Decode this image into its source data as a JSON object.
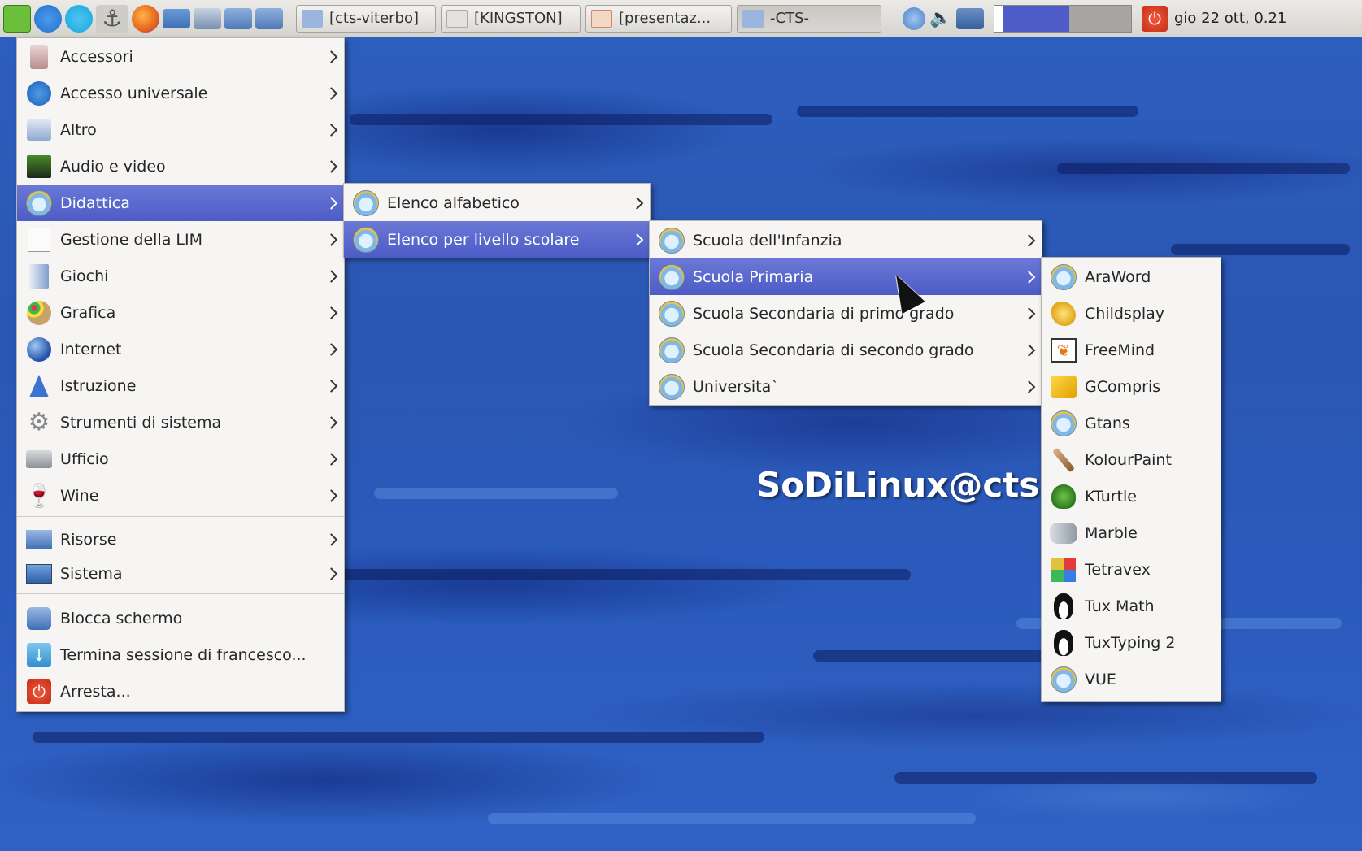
{
  "panel": {
    "launchers": [
      {
        "icon": "mint-menu-icon",
        "color": "#6cbf3a"
      },
      {
        "icon": "info-icon",
        "color": "#1f6fd1"
      },
      {
        "icon": "skype-icon",
        "color": "#18a7e0"
      },
      {
        "icon": "anchor-icon",
        "color": "#666666"
      },
      {
        "icon": "firefox-icon",
        "color": "#e8641b"
      },
      {
        "icon": "monitor-icon",
        "color": "#3d6fb5"
      },
      {
        "icon": "workspace-icon",
        "color": "#7790b0"
      },
      {
        "icon": "workspace-icon",
        "color": "#4f79b8"
      },
      {
        "icon": "workspace-icon",
        "color": "#4f79b8"
      }
    ],
    "tasks": [
      {
        "label": "[cts-viterbo]",
        "icon": "folder-icon"
      },
      {
        "label": "[KINGSTON]",
        "icon": "drive-icon"
      },
      {
        "label": "[presentaz...",
        "icon": "presentation-icon"
      },
      {
        "label": "-CTS-",
        "icon": "folder-icon"
      }
    ],
    "tray": [
      "info-icon",
      "volume-icon",
      "network-icon"
    ],
    "clock": "gio 22 ott, 0.21"
  },
  "wallpaper_text": "SoDiLinux@cts",
  "main_menu": {
    "categories": [
      {
        "label": "Accessori",
        "icon": "accessories-icon"
      },
      {
        "label": "Accesso universale",
        "icon": "accessibility-icon"
      },
      {
        "label": "Altro",
        "icon": "other-icon"
      },
      {
        "label": "Audio e video",
        "icon": "audio-video-icon"
      },
      {
        "label": "Didattica",
        "icon": "education-owl-icon"
      },
      {
        "label": "Gestione della LIM",
        "icon": "whiteboard-icon"
      },
      {
        "label": "Giochi",
        "icon": "games-icon"
      },
      {
        "label": "Grafica",
        "icon": "graphics-icon"
      },
      {
        "label": "Internet",
        "icon": "internet-globe-icon"
      },
      {
        "label": "Istruzione",
        "icon": "science-flask-icon"
      },
      {
        "label": "Strumenti di sistema",
        "icon": "gear-icon"
      },
      {
        "label": "Ufficio",
        "icon": "office-icon"
      },
      {
        "label": "Wine",
        "icon": "wine-glass-icon"
      }
    ],
    "places": [
      {
        "label": "Risorse",
        "icon": "places-icon"
      },
      {
        "label": "Sistema",
        "icon": "system-icon"
      }
    ],
    "actions": [
      {
        "label": "Blocca schermo",
        "icon": "lock-screen-icon"
      },
      {
        "label": "Termina sessione di francesco...",
        "icon": "logout-icon"
      },
      {
        "label": "Arresta...",
        "icon": "power-icon"
      }
    ]
  },
  "submenu_didattica": [
    "Elenco alfabetico",
    "Elenco per livello scolare"
  ],
  "submenu_livello": [
    "Scuola dell'Infanzia",
    "Scuola Primaria",
    "Scuola Secondaria di primo grado",
    "Scuola Secondaria di secondo grado",
    "Universita`"
  ],
  "submenu_primaria": [
    {
      "label": "AraWord",
      "icon": "owl-icon"
    },
    {
      "label": "Childsplay",
      "icon": "childsplay-hand-icon"
    },
    {
      "label": "FreeMind",
      "icon": "butterfly-icon"
    },
    {
      "label": "GCompris",
      "icon": "gcompris-icon"
    },
    {
      "label": "Gtans",
      "icon": "owl-icon"
    },
    {
      "label": "KolourPaint",
      "icon": "paintbrush-icon"
    },
    {
      "label": "KTurtle",
      "icon": "turtle-icon"
    },
    {
      "label": "Marble",
      "icon": "marble-icon"
    },
    {
      "label": "Tetravex",
      "icon": "tetravex-icon"
    },
    {
      "label": "Tux Math",
      "icon": "tux-penguin-icon"
    },
    {
      "label": "TuxTyping 2",
      "icon": "tux-penguin-icon"
    },
    {
      "label": "VUE",
      "icon": "owl-icon"
    }
  ],
  "selection": {
    "category": "Didattica",
    "didattica_item": "Elenco per livello scolare",
    "livello_item": "Scuola Primaria"
  },
  "colors": {
    "selection": "#5563cc",
    "menu_bg": "#f6f5f3",
    "desktop": "#2a56b0"
  }
}
